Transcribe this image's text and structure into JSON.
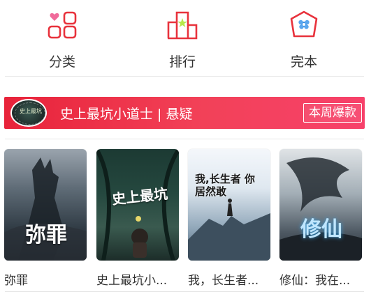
{
  "nav": {
    "items": [
      {
        "label": "分类",
        "icon": "category-grid-icon"
      },
      {
        "label": "排行",
        "icon": "ranking-podium-icon"
      },
      {
        "label": "完本",
        "icon": "completed-badge-icon"
      }
    ]
  },
  "banner": {
    "title": "史上最坑小道士 | 悬疑",
    "tag": "本周爆款",
    "avatar_text": "史上最坑"
  },
  "books": [
    {
      "title": "弥罪",
      "cover_title": "弥罪"
    },
    {
      "title": "史上最坑小...",
      "cover_title": "史上最坑"
    },
    {
      "title": "我，长生者...",
      "cover_title": "我,长生者 你居然敢"
    },
    {
      "title": "修仙：我在...",
      "cover_title": "修仙"
    }
  ],
  "colors": {
    "accent": "#e8233a",
    "icon_red": "#e8323c",
    "icon_star": "#b7e84a",
    "icon_flower": "#3a8dde"
  }
}
